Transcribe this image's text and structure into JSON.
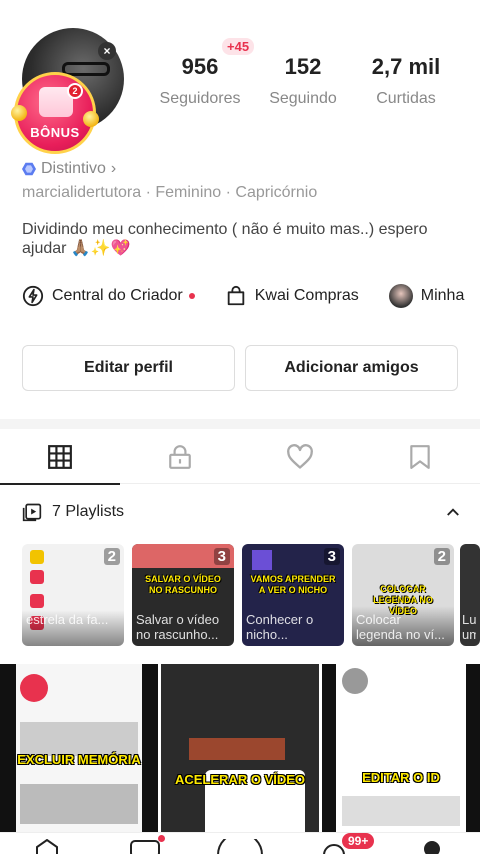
{
  "profile": {
    "bonus_label": "BÔNUS",
    "bonus_badge": "2",
    "new_followers": "+45",
    "stats": [
      {
        "value": "956",
        "label": "Seguidores"
      },
      {
        "value": "152",
        "label": "Seguindo"
      },
      {
        "value": "2,7 mil",
        "label": "Curtidas"
      }
    ],
    "distintivo": "Distintivo",
    "meta": "marcialidertutora · Feminino · Capricórnio",
    "bio": "Dividindo meu conhecimento ( não é muito mas..) espero ajudar 🙏🏽✨💖"
  },
  "quick_links": {
    "creator": "Central do Criador",
    "shop": "Kwai Compras",
    "more": "Minha"
  },
  "buttons": {
    "edit": "Editar perfil",
    "add_friends": "Adicionar amigos"
  },
  "playlists": {
    "label": "7 Playlists",
    "items": [
      {
        "count": "2",
        "title": "estrela da fa...",
        "overlay": ""
      },
      {
        "count": "3",
        "title": "Salvar o vídeo no rascunho...",
        "overlay": "SALVAR O VÍDEO NO RASCUNHO"
      },
      {
        "count": "3",
        "title": "Conhecer o nicho...",
        "overlay": "VAMOS APRENDER A VER O NICHO"
      },
      {
        "count": "2",
        "title": "Colocar legenda no ví...",
        "overlay": "COLOCAR LEGENDA NO VÍDEO"
      },
      {
        "count": "",
        "title": "Lu... um...",
        "overlay": ""
      }
    ]
  },
  "videos": [
    {
      "caption": "EXCLUIR MEMÓRIA"
    },
    {
      "caption": "ACELERAR O VÍDEO"
    },
    {
      "caption": "EDITAR O ID"
    }
  ],
  "nav": {
    "notifications": "99+"
  },
  "colors": {
    "accent_red": "#e8324e",
    "muted_text": "#888888",
    "caption_yellow": "#ffea00"
  }
}
